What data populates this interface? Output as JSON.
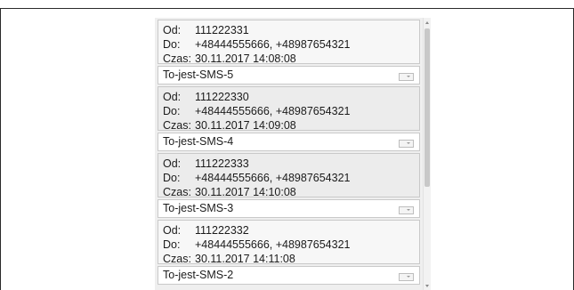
{
  "labels": {
    "from": "Od:",
    "to": "Do:",
    "time": "Czas:"
  },
  "messages": [
    {
      "from": "111222331",
      "to": "+48444555666, +48987654321",
      "time": "30.11.2017 14:08:08",
      "text": "To-jest-SMS-5",
      "shade": "plain"
    },
    {
      "from": "111222330",
      "to": "+48444555666, +48987654321",
      "time": "30.11.2017 14:09:08",
      "text": "To-jest-SMS-4",
      "shade": "alt"
    },
    {
      "from": "111222333",
      "to": "+48444555666, +48987654321",
      "time": "30.11.2017 14:10:08",
      "text": "To-jest-SMS-3",
      "shade": "alt"
    },
    {
      "from": "111222332",
      "to": "+48444555666, +48987654321",
      "time": "30.11.2017 14:11:08",
      "text": "To-jest-SMS-2",
      "shade": "plain"
    }
  ],
  "icons": {
    "scroll_up": "chevron-up-icon",
    "scroll_down": "chevron-down-icon",
    "resize": "dropdown-handle-icon"
  }
}
